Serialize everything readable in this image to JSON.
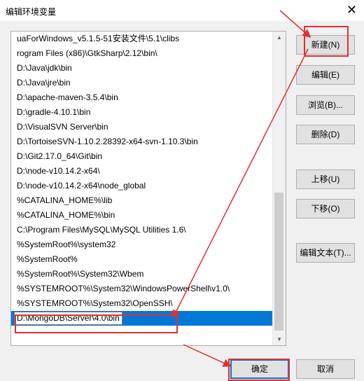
{
  "window": {
    "title": "编辑环境变量",
    "close_glyph": "✕"
  },
  "list": {
    "items": [
      "uaForWindows_v5.1.5-51安装文件\\5.1\\clibs",
      "rogram Files (x86)\\GtkSharp\\2.12\\bin\\",
      "D:\\Java\\jdk\\bin",
      "D:\\Java\\jre\\bin",
      "D:\\apache-maven-3.5.4\\bin",
      "D:\\gradle-4.10.1\\bin",
      "D:\\VisualSVN Server\\bin",
      "D:\\TortoiseSVN-1.10.2.28392-x64-svn-1.10.3\\bin",
      "D:\\Git2.17.0_64\\Git\\bin",
      "D:\\node-v10.14.2-x64\\",
      "D:\\node-v10.14.2-x64\\node_global",
      "%CATALINA_HOME%\\lib",
      "%CATALINA_HOME%\\bin",
      "C:\\Program Files\\MySQL\\MySQL Utilities 1.6\\",
      "%SystemRoot%\\system32",
      "%SystemRoot%",
      "%SystemRoot%\\System32\\Wbem",
      "%SYSTEMROOT%\\System32\\WindowsPowerShell\\v1.0\\",
      "%SYSTEMROOT%\\System32\\OpenSSH\\"
    ],
    "editing_value": "D:\\MongoDB\\Server\\4.0\\bin"
  },
  "buttons": {
    "new_text": "新建",
    "new_key": "(N)",
    "edit_text": "编辑",
    "edit_key": "(E)",
    "browse_text": "浏览",
    "browse_key": "(B)...",
    "delete_text": "删除",
    "delete_key": "(D)",
    "up_text": "上移",
    "up_key": "(U)",
    "down_text": "下移",
    "down_key": "(O)",
    "edittext_text": "编辑文本",
    "edittext_key": "(T)...",
    "ok": "确定",
    "cancel": "取消"
  },
  "annotation_color": "#e03030"
}
